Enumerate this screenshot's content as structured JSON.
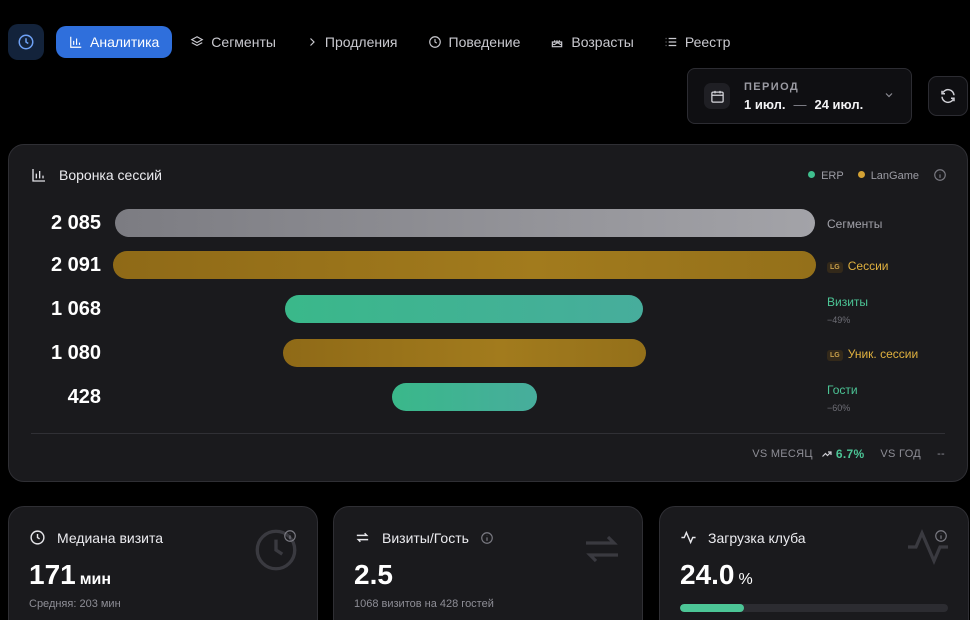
{
  "nav": {
    "tabs": [
      {
        "label": "Аналитика",
        "icon": "bar-chart-icon",
        "active": true
      },
      {
        "label": "Сегменты",
        "icon": "layers-icon"
      },
      {
        "label": "Продления",
        "icon": "chevron-right-icon"
      },
      {
        "label": "Поведение",
        "icon": "clock-icon"
      },
      {
        "label": "Возрасты",
        "icon": "cake-icon"
      },
      {
        "label": "Реестр",
        "icon": "list-icon"
      }
    ]
  },
  "period": {
    "label": "ПЕРИОД",
    "from": "1 июл.",
    "separator": "—",
    "to": "24 июл."
  },
  "funnel": {
    "title": "Воронка сессий",
    "legend": [
      {
        "label": "ERP",
        "color": "#3fbf8e"
      },
      {
        "label": "LanGame",
        "color": "#d4a234"
      }
    ],
    "badge": "LG",
    "rows": [
      {
        "value": "2 085",
        "label": "Сегменты",
        "color": "#a3a3a8",
        "sub": ""
      },
      {
        "value": "2 091",
        "label": "Сессии",
        "color": "#d4a234",
        "sub": ""
      },
      {
        "value": "1 068",
        "label": "Визиты",
        "color": "#4cc596",
        "sub": "−49%"
      },
      {
        "value": "1 080",
        "label": "Уник. сессии",
        "color": "#d4a234",
        "sub": ""
      },
      {
        "value": "428",
        "label": "Гости",
        "color": "#4cc596",
        "sub": "−60%"
      }
    ],
    "compare": {
      "month_label": "VS МЕСЯЦ",
      "month_value": "6.7%",
      "year_label": "VS ГОД",
      "year_value": "--"
    }
  },
  "kpis": {
    "median": {
      "title": "Медиана визита",
      "value": "171",
      "unit": "мин",
      "sub": "Средняя: 203 мин"
    },
    "visits": {
      "title": "Визиты/Гость",
      "value": "2.5",
      "sub": "1068 визитов на 428 гостей"
    },
    "load": {
      "title": "Загрузка клуба",
      "value": "24.0",
      "unit": "%",
      "progress": 0.24
    }
  }
}
